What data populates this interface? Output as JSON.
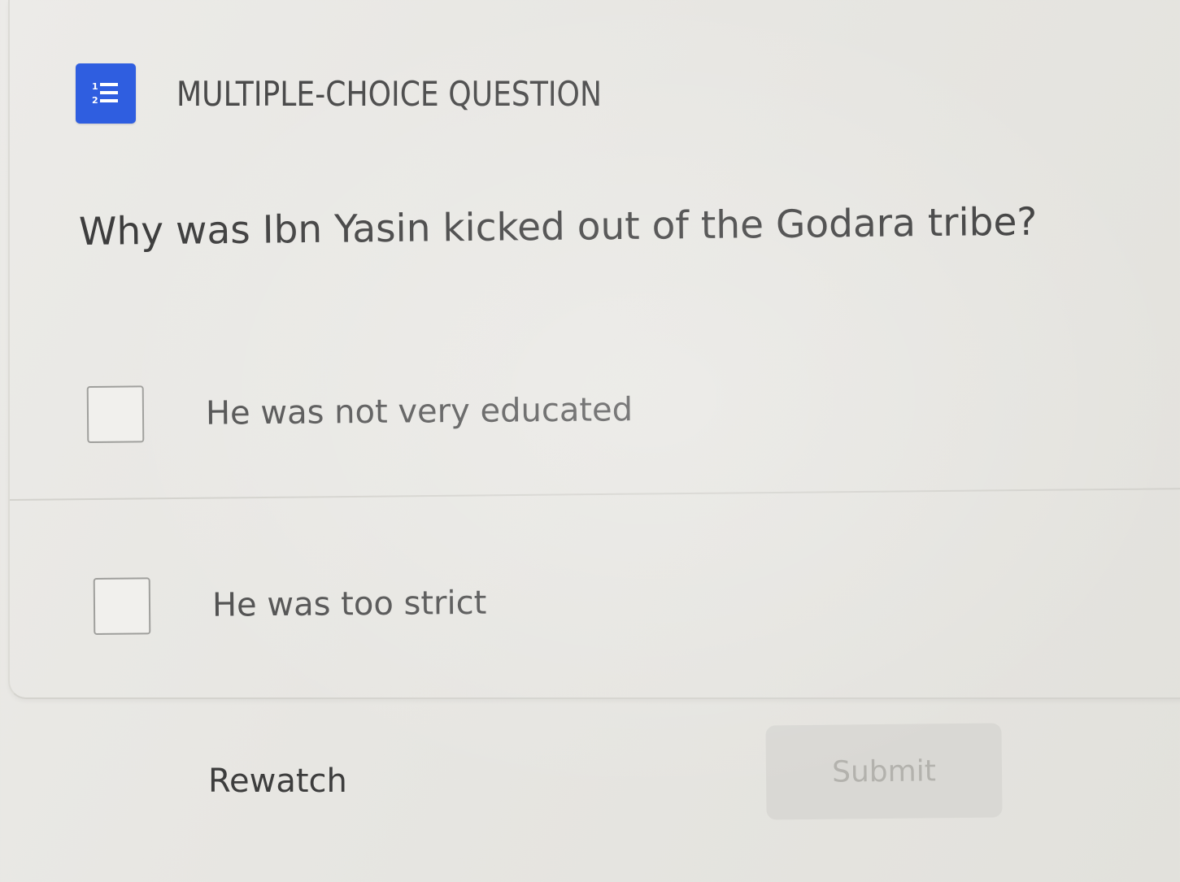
{
  "header": {
    "icon": "numbered-list-icon",
    "icon_color": "#2f5ee0",
    "title": "MULTIPLE-CHOICE QUESTION"
  },
  "question": {
    "text": "Why was Ibn Yasin kicked out of the Godara tribe?"
  },
  "options": [
    {
      "label": "He was not very educated",
      "checked": false
    },
    {
      "label": "He was too strict",
      "checked": false
    }
  ],
  "actions": {
    "rewatch_label": "Rewatch",
    "submit_label": "Submit",
    "submit_disabled": true
  }
}
